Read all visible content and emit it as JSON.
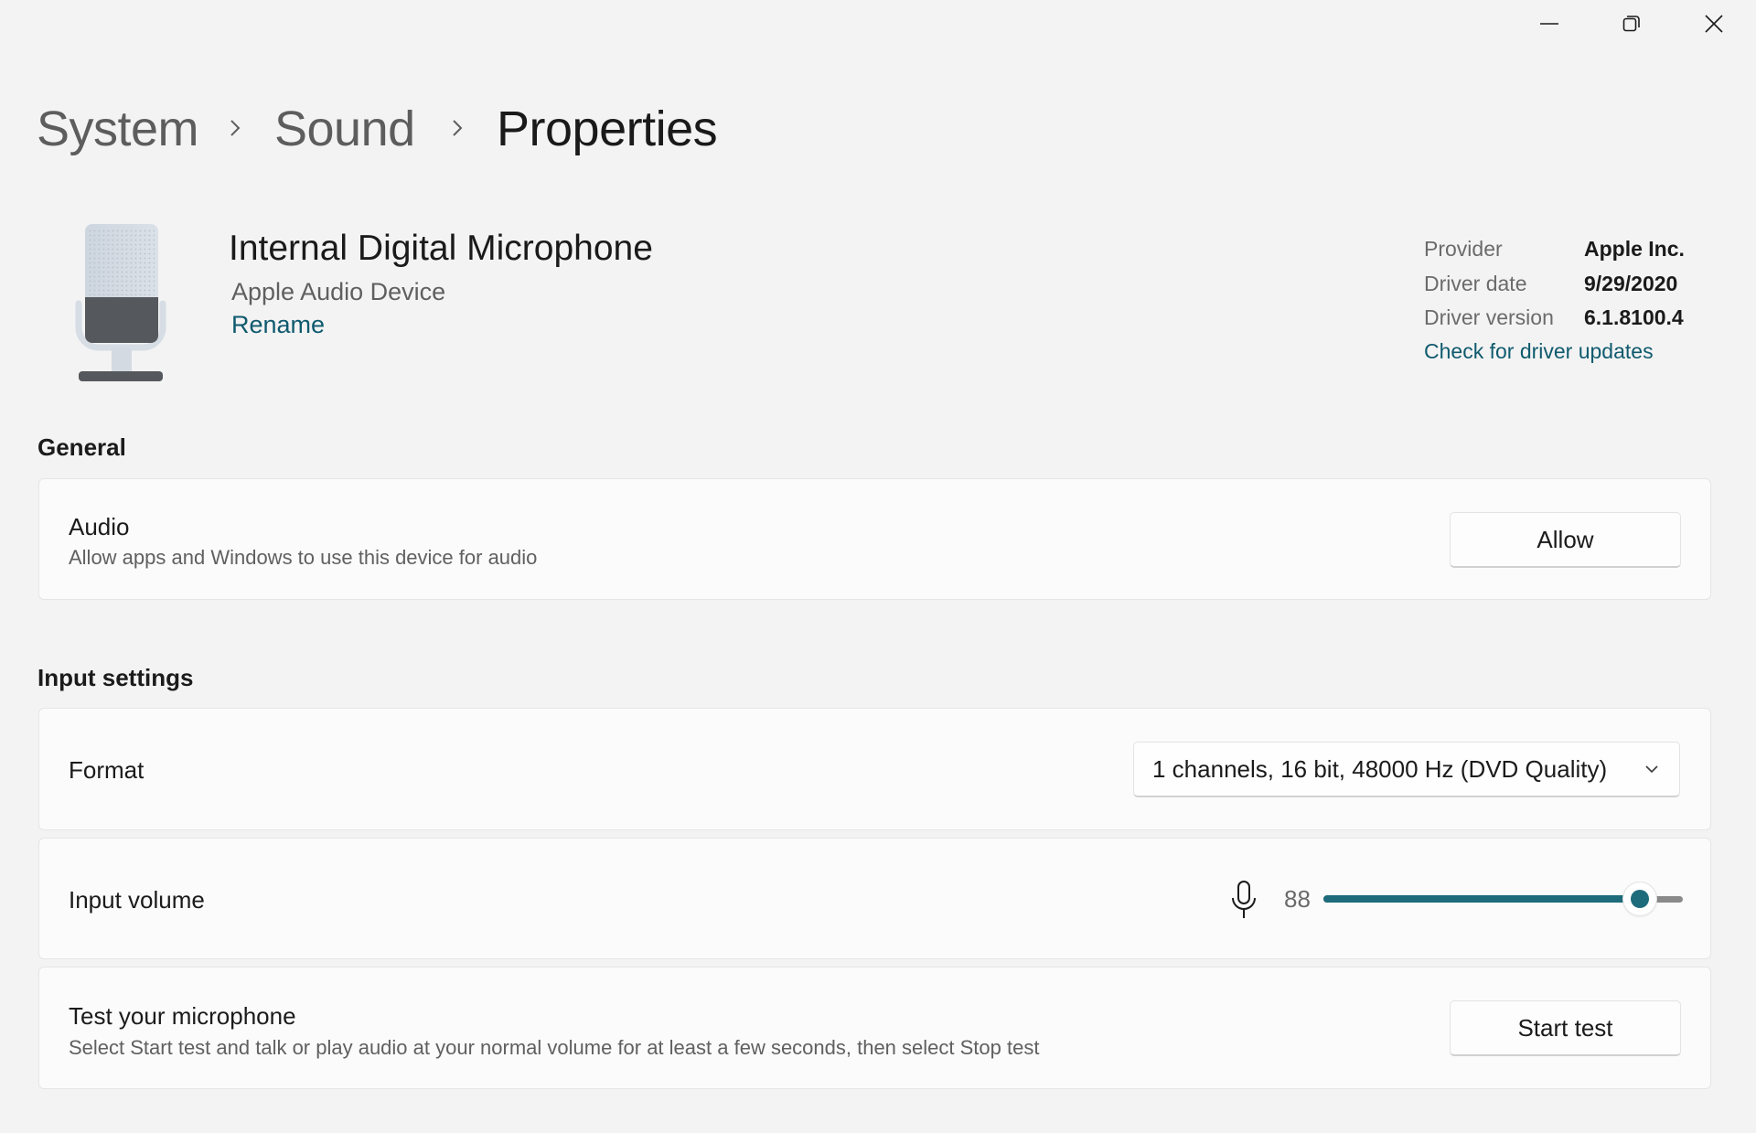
{
  "window": {
    "controls": [
      {
        "name": "minimize-icon"
      },
      {
        "name": "restore-icon"
      },
      {
        "name": "close-icon"
      }
    ]
  },
  "breadcrumb": {
    "items": [
      "System",
      "Sound",
      "Properties"
    ],
    "separator_icon": "chevron-right-icon"
  },
  "device": {
    "icon": "microphone-device-icon",
    "name": "Internal Digital Microphone",
    "type": "Apple Audio Device",
    "rename_link": "Rename"
  },
  "driver": {
    "rows": [
      {
        "label": "Provider",
        "value": "Apple Inc."
      },
      {
        "label": "Driver date",
        "value": "9/29/2020"
      },
      {
        "label": "Driver version",
        "value": "6.1.8100.4"
      }
    ],
    "update_link": "Check for driver updates"
  },
  "general": {
    "heading": "General",
    "audio": {
      "title": "Audio",
      "description": "Allow apps and Windows to use this device for audio",
      "button": "Allow"
    }
  },
  "input_settings": {
    "heading": "Input settings",
    "format": {
      "title": "Format",
      "selected": "1 channels, 16 bit, 48000 Hz (DVD Quality)"
    },
    "volume": {
      "title": "Input volume",
      "icon": "microphone-icon",
      "value": "88",
      "percent": 88
    },
    "test": {
      "title": "Test your microphone",
      "description": "Select Start test and talk or play audio at your normal volume for at least a few seconds, then select Stop test",
      "button": "Start test"
    }
  },
  "colors": {
    "accent": "#1e6b7c",
    "link": "#0f5a6e",
    "background": "#f3f3f3",
    "card": "#fbfbfb"
  }
}
